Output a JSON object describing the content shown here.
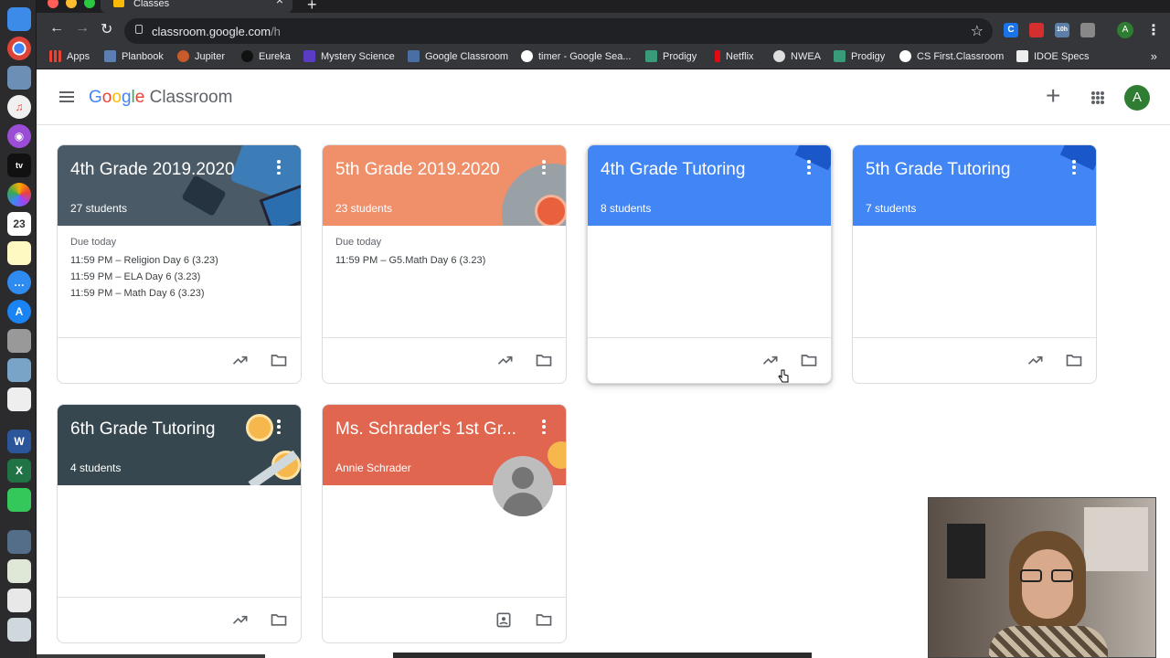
{
  "browser": {
    "tab_title": "Classes",
    "url_host": "classroom.google.com",
    "url_path": "/h",
    "bookmarks": [
      {
        "label": "Apps"
      },
      {
        "label": "Planbook"
      },
      {
        "label": "Jupiter"
      },
      {
        "label": "Eureka"
      },
      {
        "label": "Mystery Science"
      },
      {
        "label": "Google Classroom"
      },
      {
        "label": "timer - Google Sea..."
      },
      {
        "label": "Prodigy"
      },
      {
        "label": "Netflix"
      },
      {
        "label": "NWEA"
      },
      {
        "label": "Prodigy"
      },
      {
        "label": "CS First.Classroom"
      },
      {
        "label": "IDOE Specs"
      }
    ],
    "more": "»",
    "profile_initial": "A",
    "ext_badge": "10h"
  },
  "app": {
    "logo_google": "Google",
    "logo_product": "Classroom",
    "avatar_initial": "A"
  },
  "classes": [
    {
      "title": "4th Grade 2019.2020",
      "subtitle": "27 students",
      "color": "#4a5a66",
      "due_label": "Due today",
      "due_items": [
        "11:59 PM – Religion Day 6 (3.23)",
        "11:59 PM – ELA Day 6 (3.23)",
        "11:59 PM – Math Day 6 (3.23)"
      ]
    },
    {
      "title": "5th Grade 2019.2020",
      "subtitle": "23 students",
      "color": "#f0906a",
      "due_label": "Due today",
      "due_items": [
        "11:59 PM – G5.Math Day 6 (3.23)"
      ]
    },
    {
      "title": "4th Grade Tutoring",
      "subtitle": "8 students",
      "color": "#4285f4",
      "due_label": "",
      "due_items": []
    },
    {
      "title": "5th Grade Tutoring",
      "subtitle": "7 students",
      "color": "#4285f4",
      "due_label": "",
      "due_items": []
    },
    {
      "title": "6th Grade Tutoring",
      "subtitle": "4 students",
      "color": "#37474f",
      "due_label": "",
      "due_items": []
    },
    {
      "title": "Ms. Schrader's 1st Gr...",
      "subtitle": "Annie Schrader",
      "color": "#e0664f",
      "due_label": "",
      "due_items": []
    }
  ]
}
